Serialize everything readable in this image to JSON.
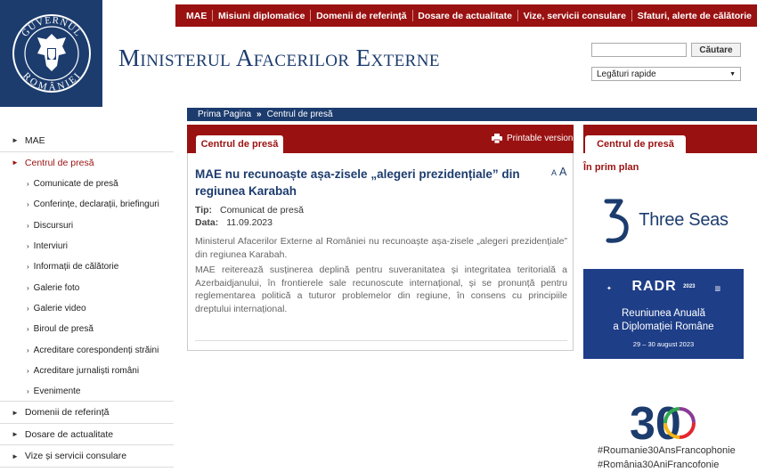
{
  "top_nav": [
    "MAE",
    "Misiuni diplomatice",
    "Domenii de referință",
    "Dosare de actualitate",
    "Vize, servicii consulare",
    "Sfaturi, alerte de călătorie"
  ],
  "site_title": "Ministerul Afacerilor Externe",
  "logo_text": {
    "top": "GUVERNUL",
    "bottom": "ROMÂNIEI"
  },
  "search": {
    "placeholder": "",
    "button": "Căutare"
  },
  "quick_links": "Legături rapide",
  "breadcrumb": {
    "home": "Prima Pagina",
    "separator": "»",
    "current": "Centrul de presă"
  },
  "main_tab": "Centrul de presă",
  "printable": "Printable version",
  "sidebar": {
    "items": [
      "MAE",
      "Centrul de presă"
    ],
    "sub_items": [
      "Comunicate de presă",
      "Conferințe, declarații, briefinguri",
      "Discursuri",
      "Interviuri",
      "Informații de călătorie",
      "Galerie foto",
      "Galerie video",
      "Biroul de presă",
      "Acreditare corespondenți străini",
      "Acreditare jurnaliști români",
      "Evenimente"
    ],
    "bottom_items": [
      "Domenii de referință",
      "Dosare de actualitate",
      "Vize și servicii consulare"
    ]
  },
  "article": {
    "title": "MAE nu recunoaște așa-zisele „alegeri prezidențiale” din regiunea Karabah",
    "font_small": "A",
    "font_large": "A",
    "type_label": "Tip:",
    "type_value": "Comunicat de presă",
    "date_label": "Data:",
    "date_value": "11.09.2023",
    "para1": "Ministerul Afacerilor Externe al României nu recunoaște așa-zisele „alegeri prezidențiale” din regiunea Karabah.",
    "para2": "MAE reiterează susținerea deplină pentru suveranitatea și integritatea teritorială a Azerbaidjanului, în frontierele sale recunoscute internațional, și se pronunță pentru reglementarea politică a tuturor problemelor din regiune, în consens cu principiile dreptului internațional."
  },
  "right": {
    "tab": "Centrul de presă",
    "spotlight": "În prim plan",
    "three_seas": "Three Seas",
    "radr": {
      "logo": "RADR",
      "year": "2023",
      "line1": "Reuniunea Anuală",
      "line2": "a Diplomației Române",
      "dates": "29 – 30 august 2023"
    },
    "francophonie": {
      "logo": "30",
      "hashtag1": "#Roumanie30AnsFrancophonie",
      "hashtag2": "#România30AniFrancofonie"
    }
  },
  "colors": {
    "red": "#9a1111",
    "navy": "#1c3c6e",
    "radr_blue": "#1e3e88"
  }
}
